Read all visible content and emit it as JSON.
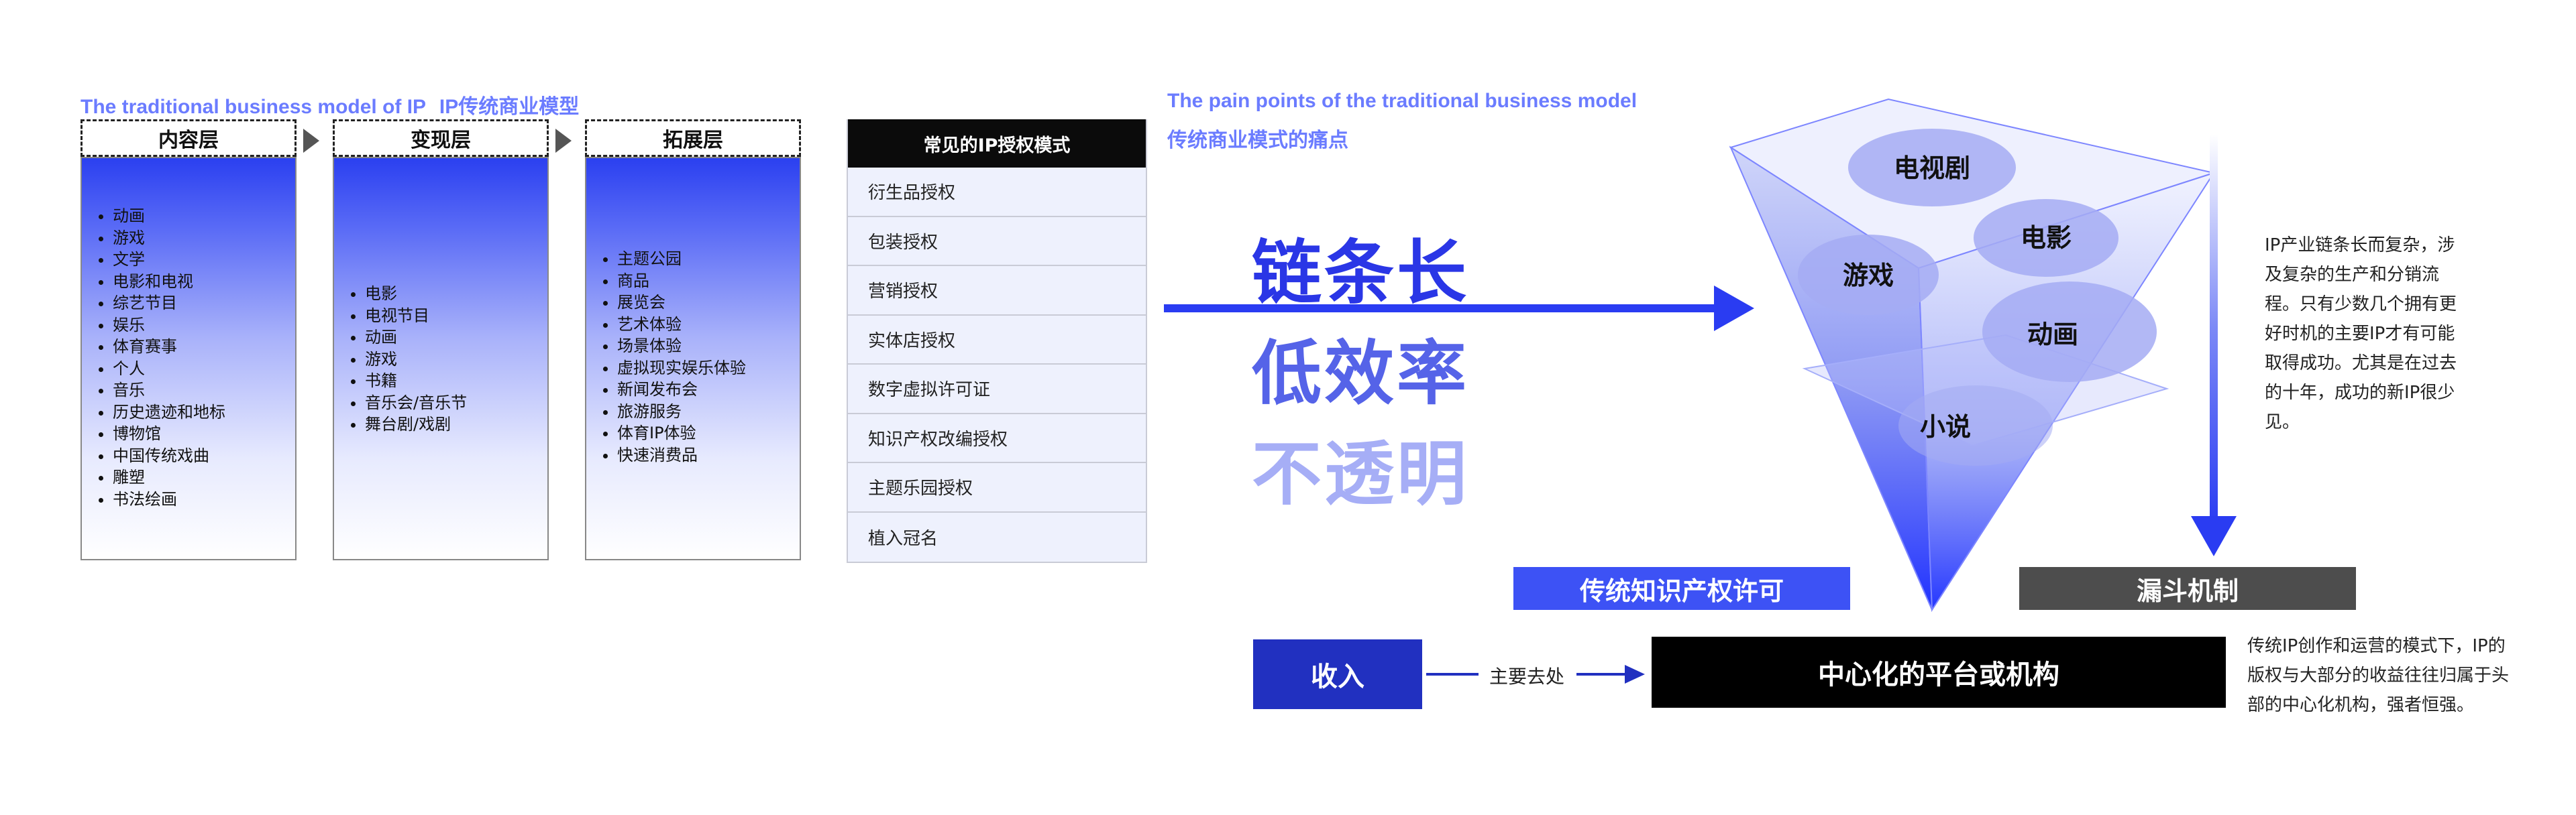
{
  "left_section": {
    "title_en": "The traditional business model of IP",
    "title_cn": "IP传统商业模型",
    "layers": [
      {
        "title": "内容层",
        "items": [
          "动画",
          "游戏",
          "文学",
          "电影和电视",
          "综艺节目",
          "娱乐",
          "体育赛事",
          "个人",
          "音乐",
          "历史遗迹和地标",
          "博物馆",
          "中国传统戏曲",
          "雕塑",
          "书法绘画"
        ]
      },
      {
        "title": "变现层",
        "items": [
          "电影",
          "电视节目",
          "动画",
          "游戏",
          "书籍",
          "音乐会/音乐节",
          "舞台剧/戏剧"
        ]
      },
      {
        "title": "拓展层",
        "items": [
          "主题公园",
          "商品",
          "展览会",
          "艺术体验",
          "场景体验",
          "虚拟现实娱乐体验",
          "新闻发布会",
          "旅游服务",
          "体育IP体验",
          "快速消费品"
        ]
      }
    ]
  },
  "license_table": {
    "header": "常见的IP授权模式",
    "rows": [
      "衍生品授权",
      "包装授权",
      "营销授权",
      "实体店授权",
      "数字虚拟许可证",
      "知识产权改编授权",
      "主题乐园授权",
      "植入冠名"
    ]
  },
  "right_section": {
    "title_en": "The pain points of the traditional business model",
    "title_cn": "传统商业模式的痛点",
    "pain_points": [
      {
        "text": "链条长",
        "color": "#2a36e6"
      },
      {
        "text": "低效率",
        "color": "#5563e8"
      },
      {
        "text": "不透明",
        "color": "#a6aef6"
      }
    ],
    "funnel_items": [
      "电视剧",
      "电影",
      "游戏",
      "动画",
      "小说"
    ],
    "traditional_license_label": "传统知识产权许可",
    "funnel_mechanism_label": "漏斗机制",
    "funnel_desc": "IP产业链条长而复杂，涉及复杂的生产和分销流程。只有少数几个拥有更好时机的主要IP才有可能取得成功。尤其是在过去的十年，成功的新IP很少见。",
    "revenue_label": "收入",
    "flow_label": "主要去处",
    "platform_label": "中心化的平台或机构",
    "platform_desc": "传统IP创作和运营的模式下，IP的版权与大部分的收益往往归属于头部的中心化机构，强者恒强。"
  },
  "colors": {
    "accent_blue": "#2a3cf2",
    "title_blue": "#6b7cff",
    "dark_navy": "#2130c0",
    "black": "#000000",
    "gray_bar": "#4d4d4d"
  }
}
